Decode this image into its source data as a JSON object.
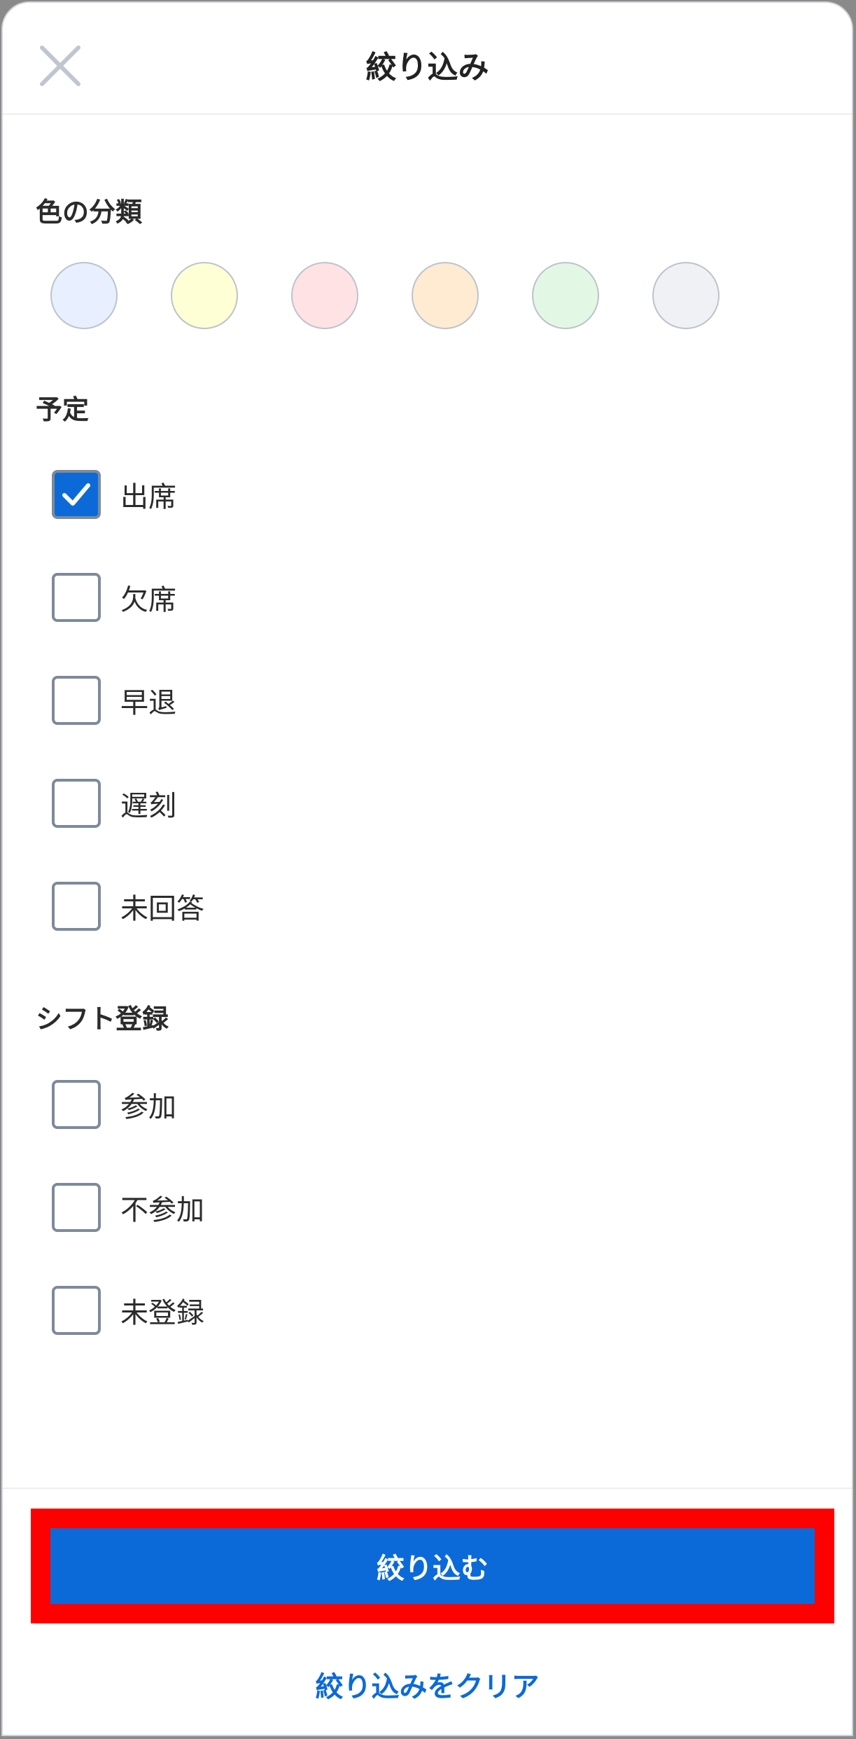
{
  "header": {
    "title": "絞り込み",
    "close_icon": "close-icon"
  },
  "color_section": {
    "label": "色の分類",
    "swatches": [
      "#e8efff",
      "#ffffd6",
      "#ffe2e4",
      "#ffebd2",
      "#e3f8e4",
      "#eff1f4"
    ]
  },
  "schedule_section": {
    "label": "予定",
    "options": [
      {
        "label": "出席",
        "checked": true
      },
      {
        "label": "欠席",
        "checked": false
      },
      {
        "label": "早退",
        "checked": false
      },
      {
        "label": "遅刻",
        "checked": false
      },
      {
        "label": "未回答",
        "checked": false
      }
    ]
  },
  "shift_section": {
    "label": "シフト登録",
    "options": [
      {
        "label": "参加",
        "checked": false
      },
      {
        "label": "不参加",
        "checked": false
      },
      {
        "label": "未登録",
        "checked": false
      }
    ]
  },
  "footer": {
    "apply_label": "絞り込む",
    "clear_label": "絞り込みをクリア"
  },
  "colors": {
    "accent": "#0b6ad8",
    "highlight": "#ff0000"
  }
}
